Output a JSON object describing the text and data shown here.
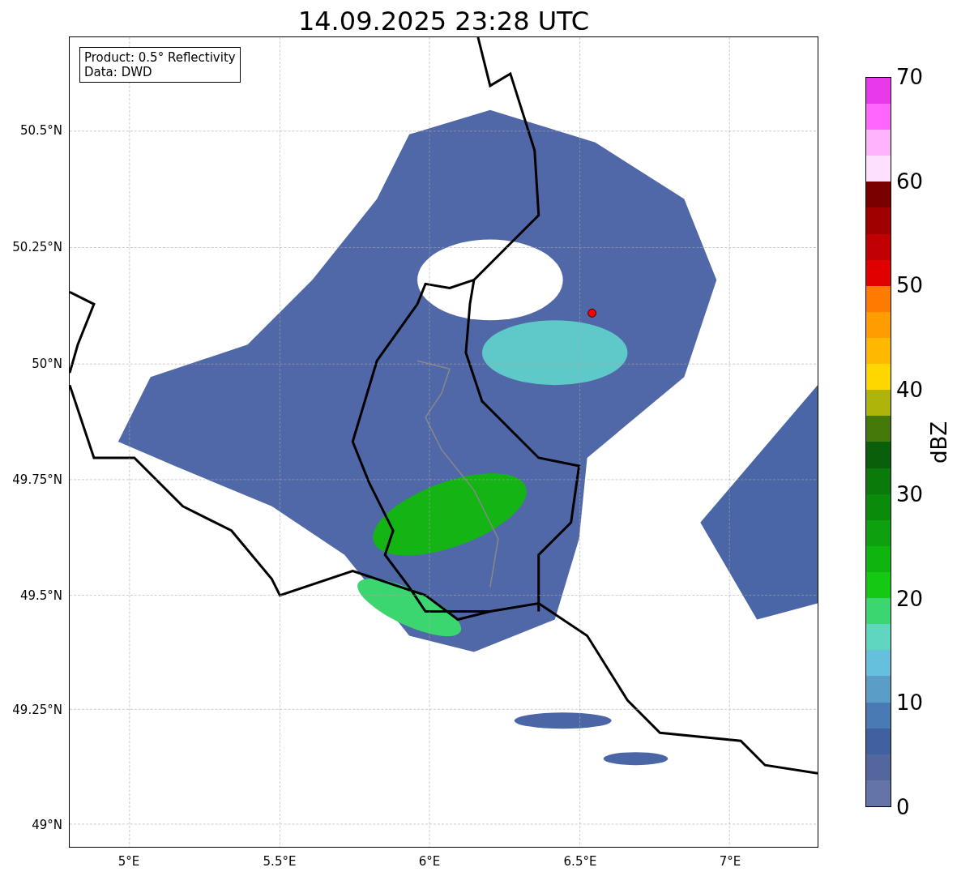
{
  "title": "14.09.2025 23:28 UTC",
  "legend": [
    "Product: 0.5° Reflectivity",
    "Data: DWD"
  ],
  "map": {
    "x_ticks": [
      "5°E",
      "5.5°E",
      "6°E",
      "6.5°E",
      "7°E"
    ],
    "y_ticks": [
      "50.5°N",
      "50.25°N",
      "50°N",
      "49.75°N",
      "49.5°N",
      "49.25°N",
      "49°N"
    ]
  },
  "colorbar": {
    "label": "dBZ",
    "ticks": [
      "70",
      "60",
      "50",
      "40",
      "30",
      "20",
      "10",
      "0"
    ],
    "bands": [
      {
        "color": "#6474a8"
      },
      {
        "color": "#53669e"
      },
      {
        "color": "#4060a0"
      },
      {
        "color": "#4a7ab4"
      },
      {
        "color": "#5a9ec8"
      },
      {
        "color": "#64c0dc"
      },
      {
        "color": "#5fd6c0"
      },
      {
        "color": "#3cd670"
      },
      {
        "color": "#14c814"
      },
      {
        "color": "#0fb40f"
      },
      {
        "color": "#0fa00f"
      },
      {
        "color": "#0a8c0a"
      },
      {
        "color": "#0a7a0a"
      },
      {
        "color": "#0a5f0a"
      },
      {
        "color": "#457a0a"
      },
      {
        "color": "#aeb40a"
      },
      {
        "color": "#ffd700"
      },
      {
        "color": "#ffb800"
      },
      {
        "color": "#ff9c00"
      },
      {
        "color": "#ff7a00"
      },
      {
        "color": "#e00000"
      },
      {
        "color": "#c00000"
      },
      {
        "color": "#a00000"
      },
      {
        "color": "#7a0000"
      },
      {
        "color": "#fde0fd"
      },
      {
        "color": "#fdb4fd"
      },
      {
        "color": "#fe66fe"
      },
      {
        "color": "#e93ae9"
      }
    ]
  }
}
